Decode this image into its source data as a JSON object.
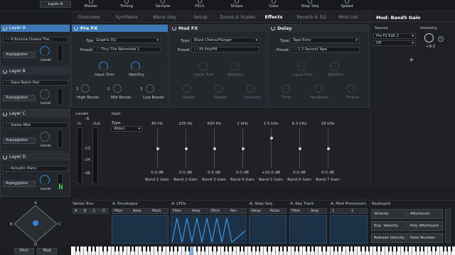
{
  "top": {
    "layer_btn": "Layer A",
    "knobs": [
      "Master",
      "Timing",
      "Sample",
      "Pitch",
      "Shape",
      "Gate",
      "Step Seq",
      "Speed"
    ]
  },
  "tabs": [
    "Overview",
    "Synthesis",
    "Wave Seq",
    "Setup",
    "Zones & Scales",
    "Effects",
    "Reverb & EQ",
    "Mod List"
  ],
  "active_tab": "Effects",
  "layers": [
    {
      "name": "Layer A",
      "preset": "A Buncha Clowns The...",
      "arp": "Arpeggiator",
      "level": "Level"
    },
    {
      "name": "Layer B",
      "preset": "Stars Notch Pad",
      "arp": "Arpeggiator",
      "level": "Level"
    },
    {
      "name": "Layer C",
      "preset": "Stellar Mist",
      "arp": "Arpeggiator",
      "level": "Level"
    },
    {
      "name": "Layer D",
      "preset": "Acoustic Piano",
      "arp": "Arpeggiator",
      "level": "Level"
    }
  ],
  "prefx": {
    "title": "Pre FX",
    "type_label": "Type",
    "type": "Graphic EQ",
    "preset_label": "Preset",
    "preset": "Thru The Wormhole 1",
    "input_trim": "Input Trim",
    "wet_dry": "Wet/Dry",
    "bands": [
      {
        "n": "1",
        "label": "High Bands"
      },
      {
        "n": "2",
        "label": "Mid Bands"
      },
      {
        "n": "3",
        "label": "Low Bands"
      }
    ]
  },
  "modfx": {
    "title": "Mod FX",
    "type_label": "Type",
    "type": "Black Chorus/Flanger",
    "preset_label": "Preset",
    "preset": "P5 PolyFM",
    "input_trim": "Input Trim",
    "wet_dry": "Wet/Dry",
    "depth": "Depth",
    "speed": "Speed",
    "intensity": "Intensity"
  },
  "delay": {
    "title": "Delay",
    "type_label": "Type",
    "type": "Tape Echo",
    "preset_label": "Preset",
    "preset": "1.2 Second Tape",
    "input_trim": "Input Trim",
    "wet_dry": "Wet/Dry",
    "time": "Time",
    "feedback": "Feedback",
    "timbre": "Timbre"
  },
  "eq": {
    "levels": "Levels",
    "in": "In",
    "out": "Out",
    "gain": "Gain",
    "type_label": "Type",
    "type": "Wide1",
    "scale": [
      "-6",
      "-12",
      "-24",
      "-48"
    ],
    "bands": [
      {
        "freq": "80 Hz",
        "value": "0.0 dB",
        "label": "Band 1 Gain",
        "level": 0.5
      },
      {
        "freq": "220 Hz",
        "value": "0.0 dB",
        "label": "Band 2 Gain",
        "level": 0.5
      },
      {
        "freq": "500 Hz",
        "value": "0.0 dB",
        "label": "Band 3 Gain",
        "level": 0.5
      },
      {
        "freq": "1 kHz",
        "value": "0.0 dB",
        "label": "Band 4 Gain",
        "level": 0.5
      },
      {
        "freq": "2.5 kHz",
        "value": "+10.0 dB",
        "label": "Band 5 Gain",
        "level": 0.25
      },
      {
        "freq": "6.3 kHz",
        "value": "0.0 dB",
        "label": "Band 6 Gain",
        "level": 0.5
      },
      {
        "freq": "16 kHz",
        "value": "0.0 dB",
        "label": "Band 7 Gain",
        "level": 0.5
      }
    ]
  },
  "modpanel": {
    "title": "Mod: Band5 Gain",
    "source_label": "Source",
    "intensity_label": "Intensity",
    "source": "Pre FX Edit 2",
    "off": "Off",
    "intensity": "+8.0",
    "add": "+"
  },
  "bottom": {
    "vector": "Vector Env",
    "vec_letters": [
      "A",
      "B",
      "C",
      "D"
    ],
    "envelopes": "A: Envelopes",
    "env_tabs": [
      "Filter",
      "Amp",
      "Pitch"
    ],
    "lfos": "A: LFOs",
    "lfo_tabs": [
      "Filter",
      "Amp",
      "Pitch",
      "Pan"
    ],
    "stepseq": "A: Step Seq",
    "step_tabs": [
      "Value",
      "Pulse"
    ],
    "keytrack": "A: Key Track",
    "kt_tabs": [
      "Filter",
      "Amp"
    ],
    "modproc": "A: Mod Processors",
    "mp_tabs": [
      "1",
      "2"
    ],
    "keyboard": "Keyboard",
    "kb_items": [
      [
        "Velocity",
        "Aftertouch"
      ],
      [
        "Exp. Velocity",
        "Poly Aftertouch"
      ],
      [
        "Release Velocity",
        "Note Number"
      ]
    ],
    "pitch": "Pitch",
    "mod": "Mod"
  }
}
